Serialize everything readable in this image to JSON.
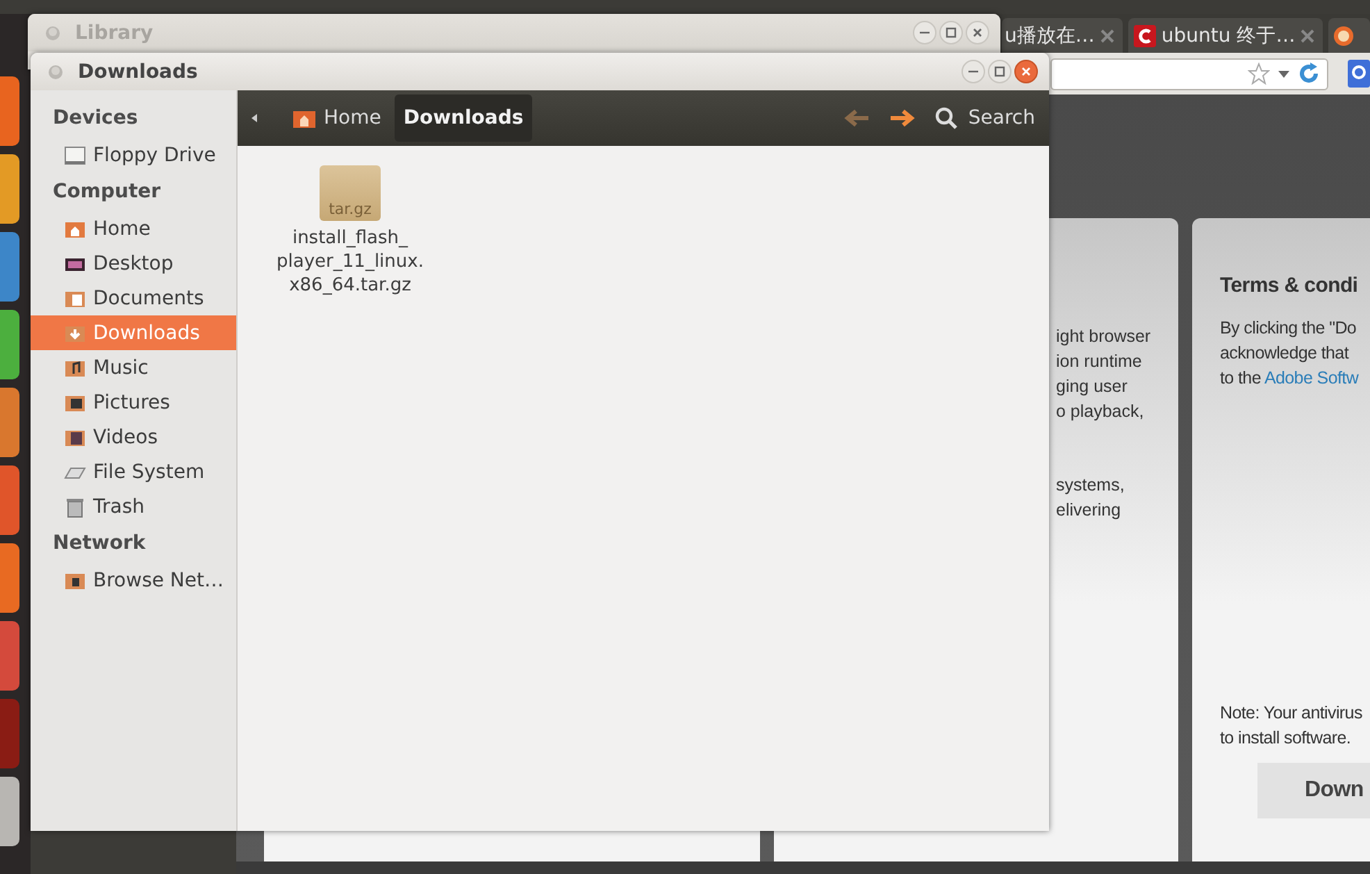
{
  "browser": {
    "tabs": [
      {
        "kind": "text",
        "label": "u播放在…"
      },
      {
        "kind": "favicon-text",
        "label": "ubuntu 终于…"
      },
      {
        "kind": "favicon"
      }
    ],
    "cards": [
      {
        "kind": "blank"
      },
      {
        "kind": "text",
        "paragraphs": [
          [
            "ight browser",
            "ion runtime",
            "ging user",
            "o playback,"
          ],
          [
            "systems,",
            "elivering"
          ]
        ]
      },
      {
        "kind": "terms",
        "title": "Terms & condi",
        "lines": [
          "By clicking the \"Do",
          "acknowledge that"
        ],
        "link_prefix": "to the",
        "link": "Adobe Softw",
        "note": [
          "Note: Your antivirus",
          "to install software."
        ],
        "button": "Down"
      }
    ]
  },
  "library_window": {
    "title": "Library",
    "active": false
  },
  "file_manager": {
    "title": "Downloads",
    "active": true,
    "sidebar": [
      {
        "title": "Devices",
        "items": [
          {
            "label": "Floppy Drive",
            "selected": false
          }
        ]
      },
      {
        "title": "Computer",
        "items": [
          {
            "label": "Home",
            "selected": false
          },
          {
            "label": "Desktop",
            "selected": false
          },
          {
            "label": "Documents",
            "selected": false
          },
          {
            "label": "Downloads",
            "selected": true
          },
          {
            "label": "Music",
            "selected": false
          },
          {
            "label": "Pictures",
            "selected": false
          },
          {
            "label": "Videos",
            "selected": false
          },
          {
            "label": "File System",
            "selected": false
          },
          {
            "label": "Trash",
            "selected": false
          }
        ]
      },
      {
        "title": "Network",
        "items": [
          {
            "label": "Browse Net…",
            "selected": false
          }
        ]
      }
    ],
    "breadcrumbs": [
      {
        "label": "Home",
        "selected": false
      },
      {
        "label": "Downloads",
        "selected": true
      }
    ],
    "back_disabled": true,
    "forward_disabled": false,
    "search": "Search",
    "files": [
      {
        "icon_label": "tar.gz",
        "name_lines": [
          "install_flash_",
          "player_11_linux.",
          "x86_64.tar.gz"
        ]
      }
    ]
  }
}
